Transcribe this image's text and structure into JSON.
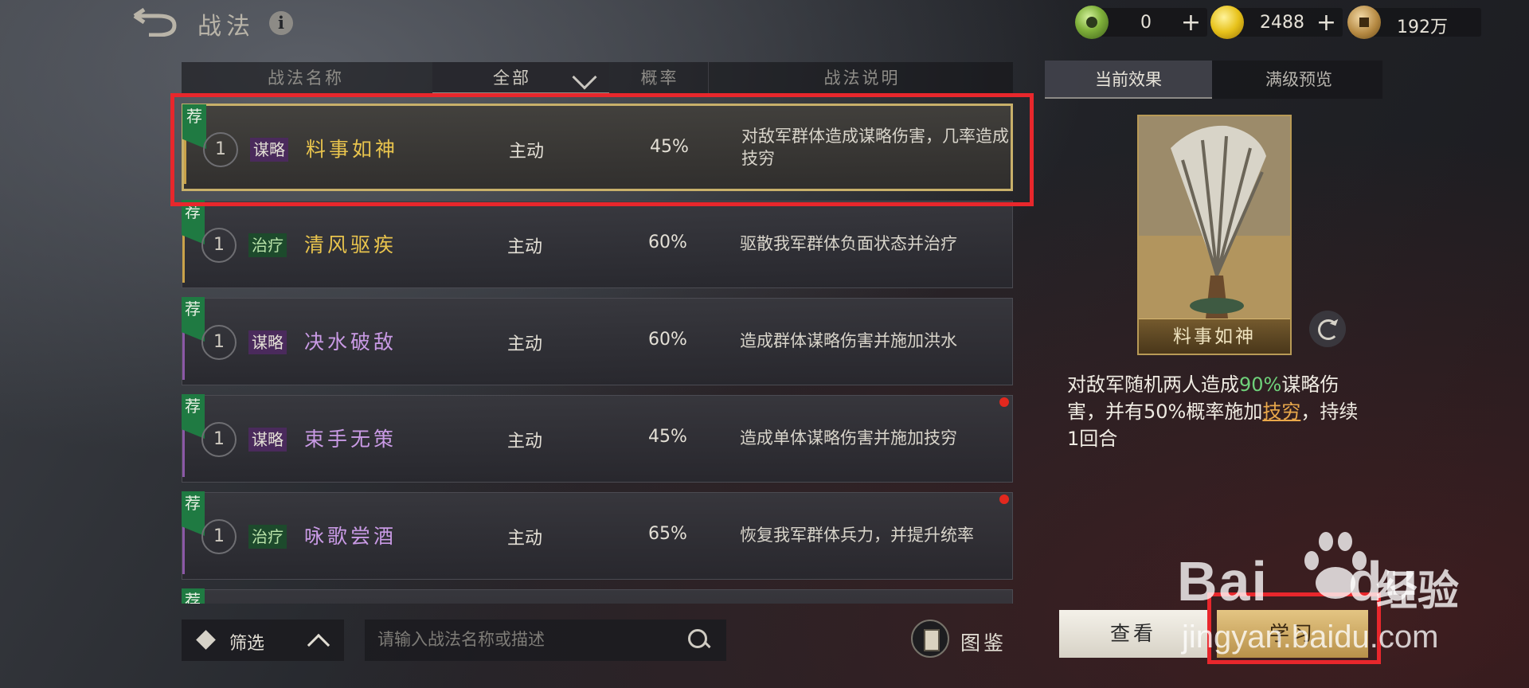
{
  "header": {
    "title": "战法",
    "info_icon": "i",
    "currencies": [
      {
        "name": "jade",
        "value": "0",
        "plus": "+"
      },
      {
        "name": "gold",
        "value": "2488",
        "plus": "+"
      },
      {
        "name": "copper",
        "value": "192万"
      }
    ]
  },
  "table": {
    "col_name": "战法名称",
    "col_filter": "全部",
    "col_rate": "概率",
    "col_desc": "战法说明"
  },
  "skills": [
    {
      "rec": "荐",
      "level": "1",
      "tag": "谋略",
      "name": "料事如神",
      "kind": "主动",
      "rate": "45%",
      "desc": "对敌军群体造成谋略伤害，几率造成技穷"
    },
    {
      "rec": "荐",
      "level": "1",
      "tag": "治疗",
      "name": "清风驱疾",
      "kind": "主动",
      "rate": "60%",
      "desc": "驱散我军群体负面状态并治疗"
    },
    {
      "rec": "荐",
      "level": "1",
      "tag": "谋略",
      "name": "决水破敌",
      "kind": "主动",
      "rate": "60%",
      "desc": "造成群体谋略伤害并施加洪水"
    },
    {
      "rec": "荐",
      "level": "1",
      "tag": "谋略",
      "name": "束手无策",
      "kind": "主动",
      "rate": "45%",
      "desc": "造成单体谋略伤害并施加技穷"
    },
    {
      "rec": "荐",
      "level": "1",
      "tag": "治疗",
      "name": "咏歌尝酒",
      "kind": "主动",
      "rate": "65%",
      "desc": "恢复我军群体兵力，并提升统率"
    },
    {
      "rec": "荐"
    }
  ],
  "bottom": {
    "filter_label": "筛选",
    "search_placeholder": "请输入战法名称或描述",
    "codex_label": "图鉴"
  },
  "panel": {
    "tab_current": "当前效果",
    "tab_max": "满级预览",
    "card_name": "料事如神",
    "effect": {
      "p1": "对敌军随机两人造成",
      "pct": "90%",
      "p2": "谋略伤害，并有50%概率施加",
      "link": "技穷",
      "p3": "，持续1回合"
    },
    "view_button": "查看",
    "learn_button": "学习"
  },
  "watermark": {
    "logo": "Bai",
    "logo2": "du",
    "cn": "经验",
    "url": "jingyan.baidu.com"
  },
  "colors": {
    "accent_gold": "#e9c44d",
    "accent_purple": "#c99ae5",
    "recommend_green": "#1f7a42",
    "highlight_red": "#e8272c"
  }
}
